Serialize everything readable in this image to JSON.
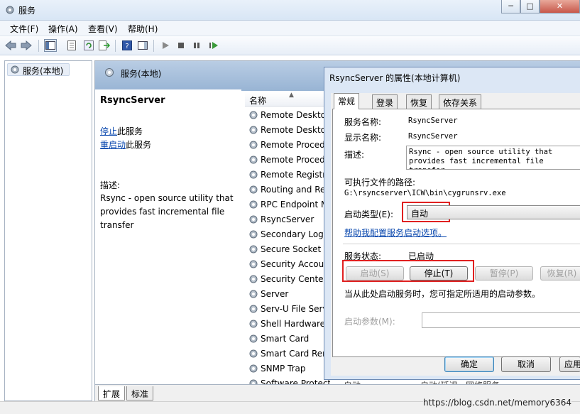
{
  "window": {
    "title": "服务"
  },
  "menu": [
    "文件(F)",
    "操作(A)",
    "查看(V)",
    "帮助(H)"
  ],
  "tree": {
    "root": "服务(本地)"
  },
  "pane": {
    "header": "服务(本地)",
    "tabs": [
      "扩展",
      "标准"
    ]
  },
  "detail": {
    "service_name": "RsyncServer",
    "stop_link": "停止",
    "stop_suffix": "此服务",
    "restart_link": "重启动",
    "restart_suffix": "此服务",
    "desc_label": "描述:",
    "description": "Rsync - open source utility that provides fast incremental file transfer"
  },
  "list": {
    "column_name": "名称",
    "rows": [
      "Remote Desktop Services",
      "Remote Desktop Services UserMode Port Redirector",
      "Remote Procedure Call (RPC)",
      "Remote Procedure Call (RPC) Locator",
      "Remote Registry",
      "Routing and Remote Access",
      "RPC Endpoint Mapper",
      "RsyncServer",
      "Secondary Logon",
      "Secure Socket Tunneling Protocol Service",
      "Security Accounts Manager",
      "Security Center",
      "Server",
      "Serv-U File Server",
      "Shell Hardware Detection",
      "Smart Card",
      "Smart Card Removal Policy",
      "SNMP Trap",
      "Software Protection"
    ],
    "partial_cells": [
      "自动",
      "自动(延迟...",
      "网络服务"
    ]
  },
  "dialog": {
    "title": "RsyncServer 的属性(本地计算机)",
    "tabs": [
      "常规",
      "登录",
      "恢复",
      "依存关系"
    ],
    "service_name_label": "服务名称:",
    "service_name_value": "RsyncServer",
    "display_name_label": "显示名称:",
    "display_name_value": "RsyncServer",
    "desc_label": "描述:",
    "desc_value": "Rsync - open source utility that provides fast incremental file transfer",
    "exe_label": "可执行文件的路径:",
    "exe_path": "G:\\rsyncserver\\ICW\\bin\\cygrunsrv.exe",
    "startup_type_label": "启动类型(E):",
    "startup_type_value": "自动",
    "help_link": "帮助我配置服务启动选项。",
    "status_label": "服务状态:",
    "status_value": "已启动",
    "btn_start": "启动(S)",
    "btn_stop": "停止(T)",
    "btn_pause": "暂停(P)",
    "btn_resume": "恢复(R)",
    "hint": "当从此处启动服务时，您可指定所适用的启动参数。",
    "param_label": "启动参数(M):",
    "param_value": "",
    "btn_ok": "确定",
    "btn_cancel": "取消",
    "btn_apply": "应用(A)"
  },
  "status_bar": {
    "watermark": "https://blog.csdn.net/memory6364"
  }
}
